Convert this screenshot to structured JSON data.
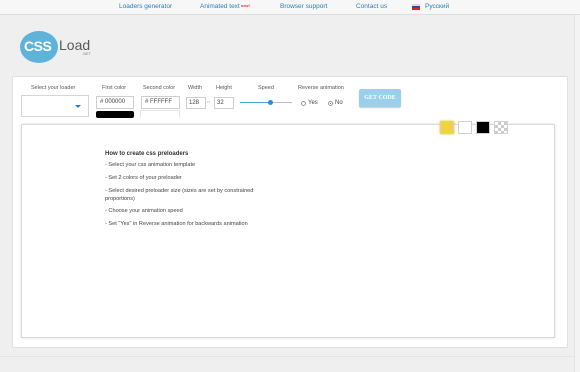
{
  "nav": {
    "items": [
      "Loaders generator",
      "Animated text",
      "Browser support",
      "Contact us",
      "Русский"
    ],
    "new_badge": "new!"
  },
  "logo": {
    "css": "CSS",
    "load": "Load",
    "net": ".NET"
  },
  "controls": {
    "loader_label": "Select your loader",
    "first_color_label": "First color",
    "first_color_value": "# 000000",
    "second_color_label": "Second color",
    "second_color_value": "# FFFFFF",
    "width_label": "Width",
    "width_value": "128",
    "height_label": "Height",
    "height_value": "32",
    "speed_label": "Speed",
    "speed_fraction": 0.58,
    "reverse_label": "Reverse animation",
    "reverse_options": [
      "Yes",
      "No"
    ],
    "reverse_selected": "No",
    "get_code_label": "GET CODE"
  },
  "preview_backgrounds": [
    "yellow",
    "white",
    "black",
    "transparent"
  ],
  "colors": {
    "accent": "#2a7fb8",
    "logo_circle": "#5fb3d9",
    "button": "#9ad0ec",
    "first_color": "#000000",
    "second_color": "#ffffff"
  },
  "instructions": {
    "title": "How to create css preloaders",
    "steps": [
      "- Select your css animation template",
      "- Set 2 colors of your preloader",
      "- Select desired preloader size (sizes are set by constrained proportions)",
      "- Choose your animation speed",
      "- Set \"Yes\" in Reverse animation for backwards animation"
    ]
  }
}
